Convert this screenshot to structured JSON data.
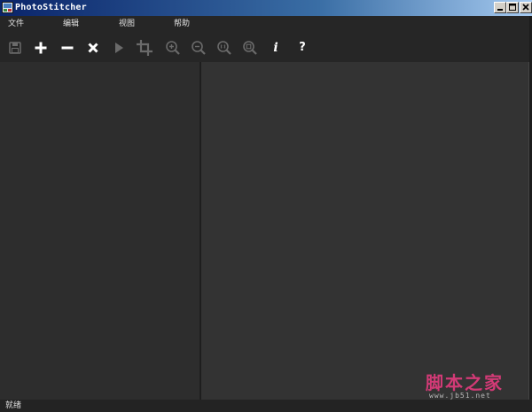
{
  "window": {
    "title": "PhotoStitcher"
  },
  "menu": {
    "file": "文件",
    "edit": "编辑",
    "view": "视图",
    "help": "帮助"
  },
  "toolbar": {
    "info_glyph": "i",
    "help_glyph": "?",
    "buttons": [
      {
        "name": "save",
        "icon": "save-icon",
        "enabled": false
      },
      {
        "name": "add",
        "icon": "plus-icon",
        "enabled": true
      },
      {
        "name": "remove",
        "icon": "minus-icon",
        "enabled": true
      },
      {
        "name": "clear",
        "icon": "x-icon",
        "enabled": true
      },
      {
        "name": "run",
        "icon": "play-icon",
        "enabled": false
      },
      {
        "name": "crop",
        "icon": "crop-icon",
        "enabled": false
      },
      {
        "name": "zoom-in",
        "icon": "zoom-in-icon",
        "enabled": false
      },
      {
        "name": "zoom-out",
        "icon": "zoom-out-icon",
        "enabled": false
      },
      {
        "name": "actual-size",
        "icon": "zoom-actual-icon",
        "enabled": false
      },
      {
        "name": "fit",
        "icon": "zoom-fit-icon",
        "enabled": false
      },
      {
        "name": "info",
        "icon": "info-icon",
        "enabled": true
      },
      {
        "name": "help",
        "icon": "question-icon",
        "enabled": true
      }
    ]
  },
  "status": {
    "text": "就绪"
  },
  "watermark": {
    "text": "脚本之家",
    "url": "www.jb51.net"
  },
  "colors": {
    "background": "#2c2c2c",
    "bar": "#262626",
    "canvas": "#333333",
    "watermark": "#d23a76"
  }
}
